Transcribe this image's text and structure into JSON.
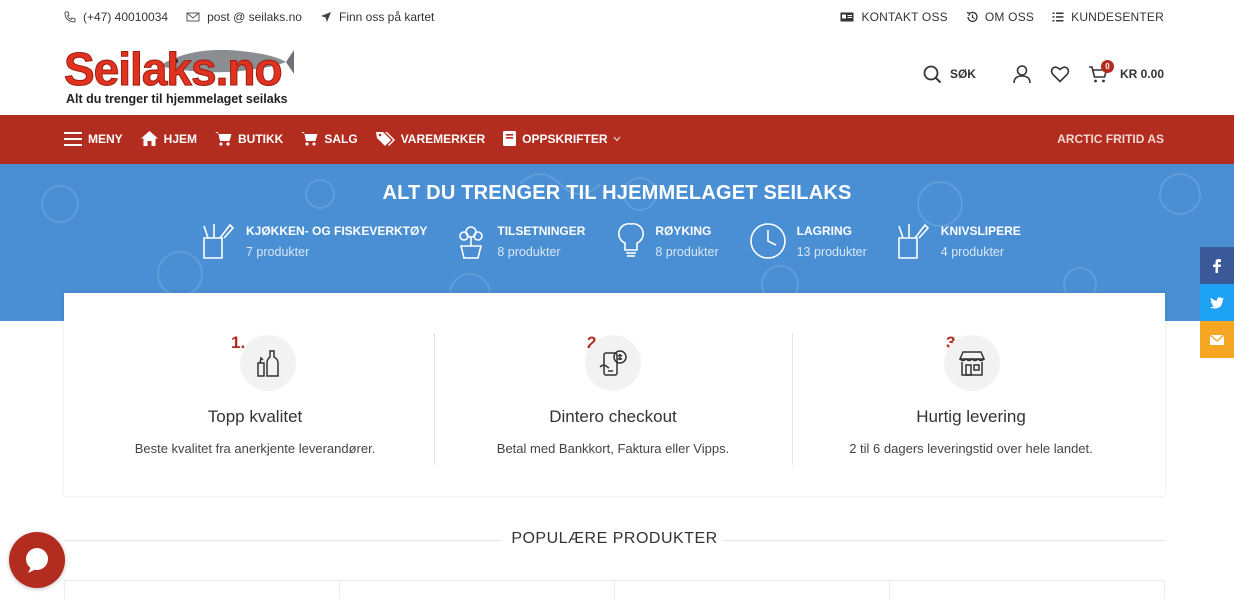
{
  "topbar": {
    "phone": "(+47) 40010034",
    "email": "post @ seilaks.no",
    "map": "Finn oss på kartet",
    "contact": "KONTAKT OSS",
    "about": "OM OSS",
    "customer": "KUNDESENTER"
  },
  "logo": {
    "brand": "Seilaks.no",
    "tagline": "Alt du trenger til hjemmelaget seilaks"
  },
  "header": {
    "search": "SØK",
    "cart_count": "0",
    "cart_total": "KR 0.00"
  },
  "nav": {
    "menu": "MENY",
    "home": "HJEM",
    "shop": "BUTIKK",
    "sale": "SALG",
    "brands": "VAREMERKER",
    "recipes": "OPPSKRIFTER",
    "company": "ARCTIC FRITID AS"
  },
  "hero": {
    "title": "ALT DU TRENGER TIL HJEMMELAGET SEILAKS",
    "categories": [
      {
        "name": "KJØKKEN- OG FISKEVERKTØY",
        "count": "7 produkter",
        "icon": "knife-block-icon"
      },
      {
        "name": "TILSETNINGER",
        "count": "8 produkter",
        "icon": "plant-pot-icon"
      },
      {
        "name": "RØYKING",
        "count": "8 produkter",
        "icon": "bulb-icon"
      },
      {
        "name": "LAGRING",
        "count": "13 produkter",
        "icon": "clock-icon"
      },
      {
        "name": "KNIVSLIPERE",
        "count": "4 produkter",
        "icon": "knife-block-icon"
      }
    ]
  },
  "features": [
    {
      "num": "1.",
      "title": "Topp kvalitet",
      "desc": "Beste kvalitet fra anerkjente leverandører."
    },
    {
      "num": "2.",
      "title": "Dintero checkout",
      "desc": "Betal med Bankkort, Faktura eller Vipps."
    },
    {
      "num": "3.",
      "title": "Hurtig levering",
      "desc": "2 til 6 dagers leveringstid over hele landet."
    }
  ],
  "popular": {
    "title": "POPULÆRE PRODUKTER"
  },
  "colors": {
    "brand_red": "#b22c1f",
    "hero_blue": "#4a8fd4",
    "facebook": "#3b5998",
    "twitter": "#1da1f2",
    "email": "#f5a623"
  }
}
